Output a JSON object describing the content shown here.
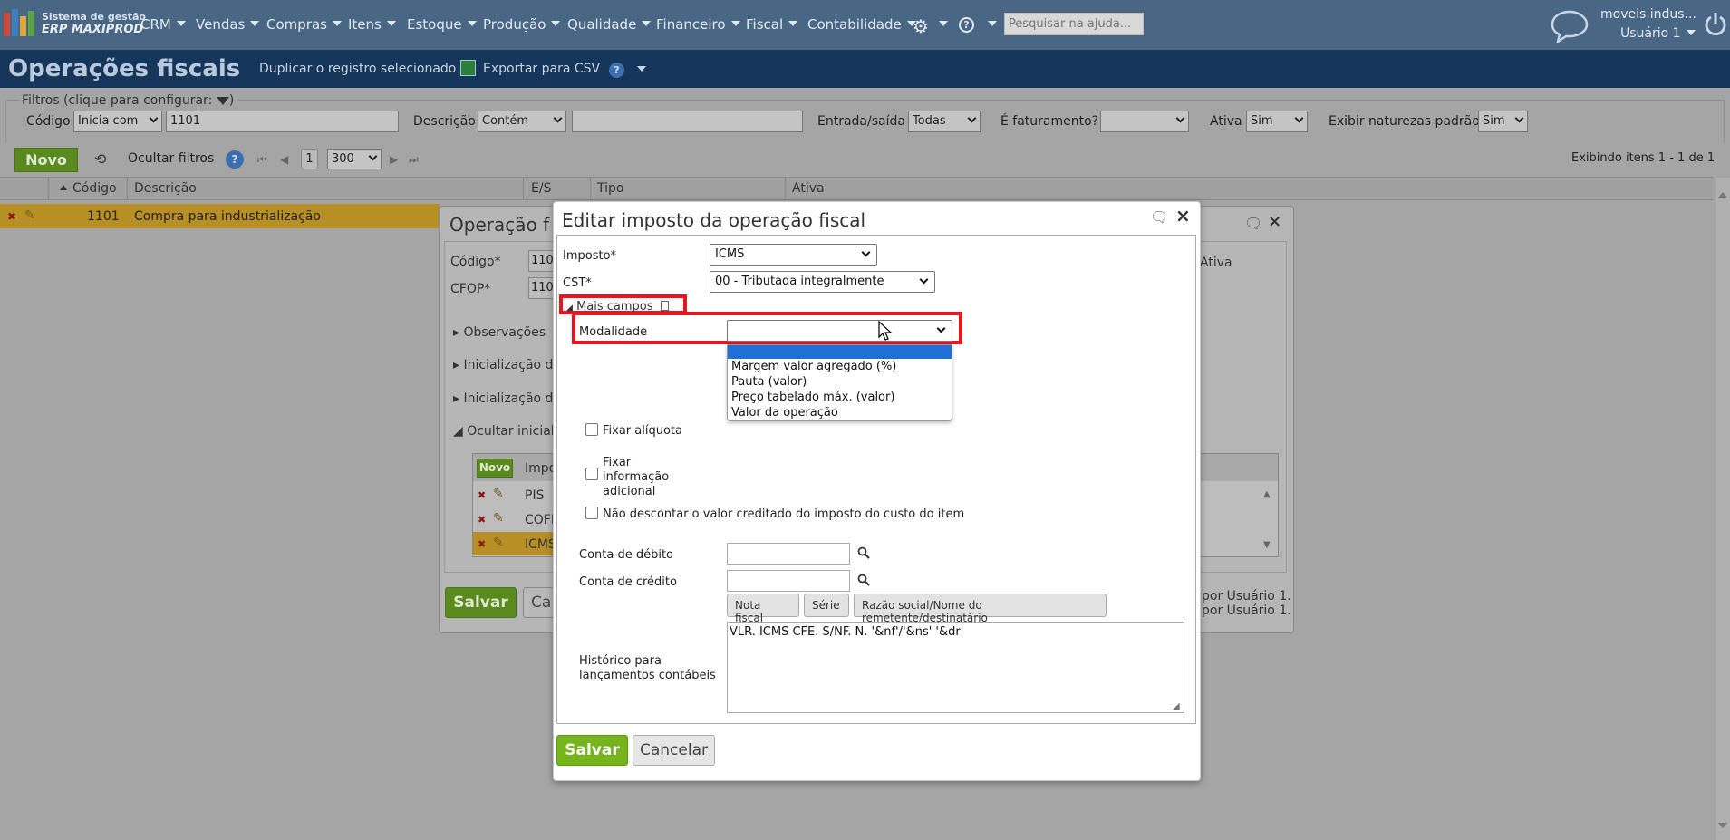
{
  "topnav": {
    "brand_line1": "Sistema de gestão",
    "brand_line2": "ERP MAXIPROD",
    "menus": [
      "CRM",
      "Vendas",
      "Compras",
      "Itens",
      "Estoque",
      "Produção",
      "Qualidade",
      "Financeiro",
      "Fiscal",
      "Contabilidade"
    ],
    "search_placeholder": "Pesquisar na ajuda...",
    "company": "moveis indus...",
    "user": "Usuário 1"
  },
  "page": {
    "title": "Operações fiscais",
    "duplicate": "Duplicar o registro selecionado",
    "export": "Exportar para CSV"
  },
  "filters": {
    "legend": "Filtros (clique para configurar:",
    "legend_end": ")",
    "codigo_label": "Código",
    "codigo_mode": "Inicia com",
    "codigo_value": "1101",
    "descricao_label": "Descrição",
    "descricao_mode": "Contém",
    "descricao_value": "",
    "entrada_label": "Entrada/saída",
    "entrada_value": "Todas",
    "faturamento_label": "É faturamento?",
    "faturamento_value": "",
    "ativa_label": "Ativa",
    "ativa_value": "Sim",
    "naturezas_label": "Exibir naturezas padrão",
    "naturezas_value": "Sim"
  },
  "toolbar": {
    "novo": "Novo",
    "ocultar": "Ocultar filtros",
    "page": "1",
    "page_size": "300",
    "showing": "Exibindo itens 1 - 1 de 1"
  },
  "grid": {
    "headers": [
      "Código",
      "Descrição",
      "E/S",
      "Tipo",
      "Ativa"
    ],
    "rows": [
      {
        "codigo": "1101",
        "descricao": "Compra para industrialização"
      }
    ]
  },
  "bgdialog": {
    "title": "Operação f",
    "codigo_label": "Código*",
    "codigo_value": "110",
    "cfop_label": "CFOP*",
    "cfop_value": "110",
    "ativa_label": "Ativa",
    "sections": [
      "Observações",
      "Inicialização d",
      "Inicialização d",
      "Ocultar iniciali"
    ],
    "subgrid_new": "Novo",
    "subgrid_header": "Impo",
    "subgrid_rows": [
      "PIS",
      "COFI",
      "ICMS"
    ],
    "audit1": "por Usuário 1.",
    "audit2": "por Usuário 1.",
    "save": "Salvar",
    "cancel": "Ca"
  },
  "modal": {
    "title": "Editar imposto da operação fiscal",
    "imposto_label": "Imposto*",
    "imposto_value": "ICMS",
    "cst_label": "CST*",
    "cst_value": "00 - Tributada integralmente",
    "mais_campos": "Mais campos",
    "modalidade_label": "Modalidade",
    "modalidade_value": "",
    "options": [
      "",
      "Margem valor agregado (%)",
      "Pauta (valor)",
      "Preço tabelado máx. (valor)",
      "Valor da operação"
    ],
    "fixar_aliquota": "Fixar alíquota",
    "fixar_info_1": "Fixar",
    "fixar_info_2": "informação",
    "fixar_info_3": "adicional",
    "nao_descontar": "Não descontar o valor creditado do imposto do custo do item",
    "conta_debito": "Conta de débito",
    "conta_credito": "Conta de crédito",
    "btn_nota": "Nota fiscal",
    "btn_serie": "Série",
    "btn_razao": "Razão social/Nome do remetente/destinatário",
    "historico_1": "Histórico para",
    "historico_2": "lançamentos contábeis",
    "historico_value": "VLR. ICMS CFE. S/NF. N. '&nf'/'&ns' '&dr'",
    "save": "Salvar",
    "cancel": "Cancelar"
  }
}
